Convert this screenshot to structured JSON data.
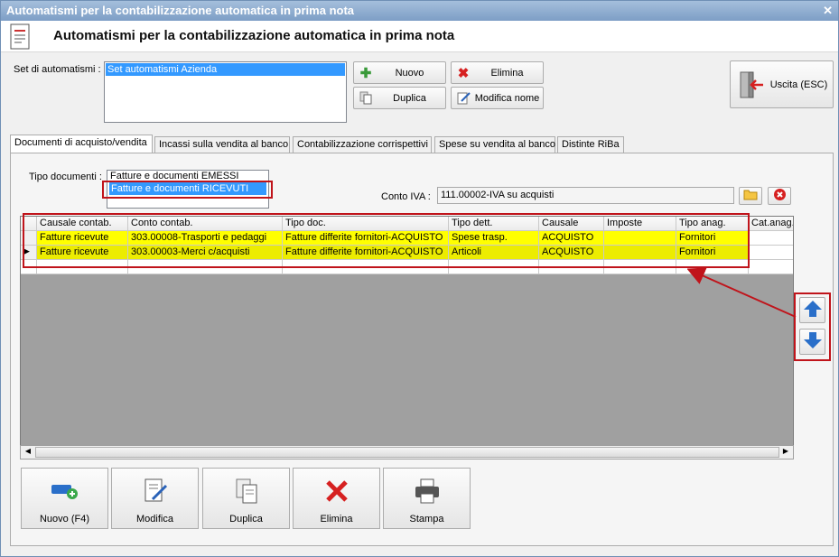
{
  "window": {
    "title": "Automatismi per la contabilizzazione automatica in prima nota"
  },
  "header": {
    "title": "Automatismi per la contabilizzazione automatica in prima nota"
  },
  "set": {
    "label": "Set di automatismi :",
    "items": [
      "Set automatismi Azienda"
    ]
  },
  "buttons": {
    "nuovo": "Nuovo",
    "elimina": "Elimina",
    "duplica": "Duplica",
    "modifica_nome": "Modifica nome",
    "uscita": "Uscita (ESC)"
  },
  "tabs": [
    "Documenti di acquisto/vendita",
    "Incassi sulla vendita al banco",
    "Contabilizzazione corrispettivi",
    "Spese su vendita al banco",
    "Distinte RiBa"
  ],
  "tipo_documenti": {
    "label": "Tipo documenti :",
    "options": [
      "Fatture e documenti EMESSI",
      "Fatture e documenti RICEVUTI"
    ]
  },
  "conto_iva": {
    "label": "Conto IVA :",
    "value": "111.00002-IVA su acquisti"
  },
  "grid": {
    "columns": [
      "Causale contab.",
      "Conto contab.",
      "Tipo doc.",
      "Tipo dett.",
      "Causale",
      "Imposte",
      "Tipo anag.",
      "Cat.anag."
    ],
    "rows": [
      [
        "Fatture ricevute",
        "303.00008-Trasporti e pedaggi",
        "Fatture differite fornitori-ACQUISTO",
        "Spese trasp.",
        "ACQUISTO",
        "",
        "Fornitori",
        ""
      ],
      [
        "Fatture ricevute",
        "303.00003-Merci c/acquisti",
        "Fatture differite fornitori-ACQUISTO",
        "Articoli",
        "ACQUISTO",
        "",
        "Fornitori",
        ""
      ]
    ]
  },
  "bottom_buttons": [
    "Nuovo (F4)",
    "Modifica",
    "Duplica",
    "Elimina",
    "Stampa"
  ],
  "colors": {
    "highlight_row": "#ffff00",
    "annotation": "#c0141b",
    "selection": "#3399ff"
  }
}
